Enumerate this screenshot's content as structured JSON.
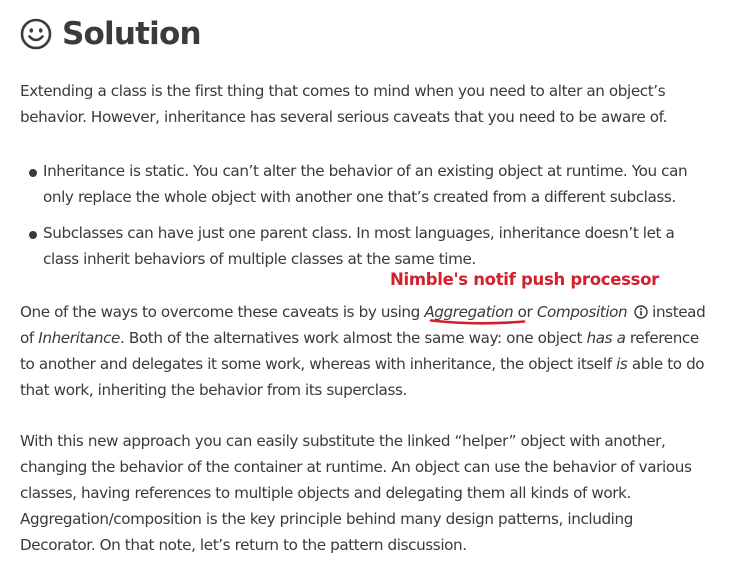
{
  "heading": {
    "title": "Solution",
    "icon": "smiley-icon"
  },
  "intro": {
    "line1": "Extending a class is the first thing that comes to mind when you need to alter an object’s",
    "line2": "behavior. However, inheritance has several serious caveats that you need to be aware of."
  },
  "bullets": [
    {
      "line1": "Inheritance is static. You can’t alter the behavior of an existing object at runtime. You can",
      "line2": "only replace the whole object with another one that’s created from a different subclass."
    },
    {
      "line1": "Subclasses can have just one parent class. In most languages, inheritance doesn’t let a",
      "line2": "class inherit behaviors of multiple classes at the same time."
    }
  ],
  "annotation": {
    "text": "Nimble's notif push processor",
    "color": "#d4202c"
  },
  "ways": {
    "l1_pre": "One of the ways to overcome these caveats is by using ",
    "l1_aggregation": "Aggregation",
    "l1_or": " or ",
    "l1_composition": "Composition",
    "l1_post": " instead",
    "l2_of": "of ",
    "l2_inheritance": "Inheritance",
    "l2_post": ". Both of the alternatives work almost the same way: one object ",
    "l2_hasa": "has a",
    "l2_end": " reference",
    "l3_pre": "to another and delegates it some work, whereas with inheritance, the object itself ",
    "l3_is": "is",
    "l3_post": " able to do",
    "l4": "that work, inheriting the behavior from its superclass."
  },
  "approach": {
    "line1": "With this new approach you can easily substitute the linked “helper” object with another,",
    "line2": "changing the behavior of the container at runtime. An object can use the behavior of various",
    "line3": "classes, having references to multiple objects and delegating them all kinds of work.",
    "line4": "Aggregation/composition is the key principle behind many design patterns, including",
    "line5": "Decorator. On that note, let’s return to the pattern discussion."
  }
}
